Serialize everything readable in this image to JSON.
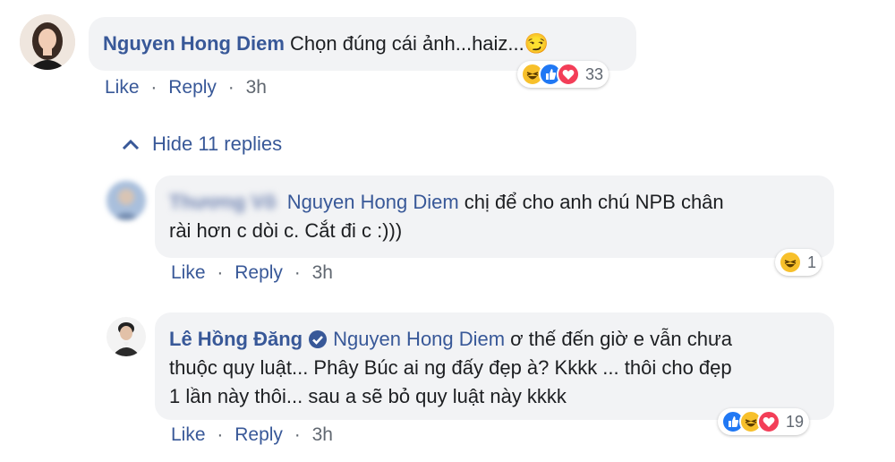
{
  "comment": {
    "author": "Nguyen Hong Diem",
    "text": "Chọn đúng cái ảnh...haiz...",
    "emoji": "😏",
    "reaction_count": "33",
    "reactions": [
      "haha-icon",
      "like-icon",
      "love-icon"
    ],
    "actions": {
      "like": "Like",
      "sep": "·",
      "reply": "Reply",
      "time": "3h"
    }
  },
  "hide_replies": "Hide 11 replies",
  "reply1": {
    "author_blurred": "Thương Võ",
    "mention": "Nguyen Hong Diem",
    "text_line1": "chị để cho anh chú NPB chân",
    "text_line2": "rài hơn c dòi c. Cắt đi c :)))",
    "reaction_count": "1",
    "reactions": [
      "haha-icon"
    ],
    "actions": {
      "like": "Like",
      "sep": "·",
      "reply": "Reply",
      "time": "3h"
    }
  },
  "reply2": {
    "author": "Lê Hồng Đăng",
    "mention": "Nguyen Hong Diem",
    "text_line1": "ơ thế đến giờ e vẫn chưa",
    "text_line2": "thuộc quy luật... Phây Búc ai ng đấy đẹp à? Kkkk ... thôi cho đẹp",
    "text_line3": "1 lần này thôi... sau a sẽ bỏ quy luật này kkkk",
    "reaction_count": "19",
    "reactions": [
      "like-icon",
      "haha-icon",
      "love-icon"
    ],
    "actions": {
      "like": "Like",
      "sep": "·",
      "reply": "Reply",
      "time": "3h"
    }
  },
  "colors": {
    "link": "#385898",
    "bubble": "#f2f3f5",
    "like_blue": "#2078f4",
    "love_red": "#f33e58",
    "haha_yellow": "#f7c02b"
  }
}
